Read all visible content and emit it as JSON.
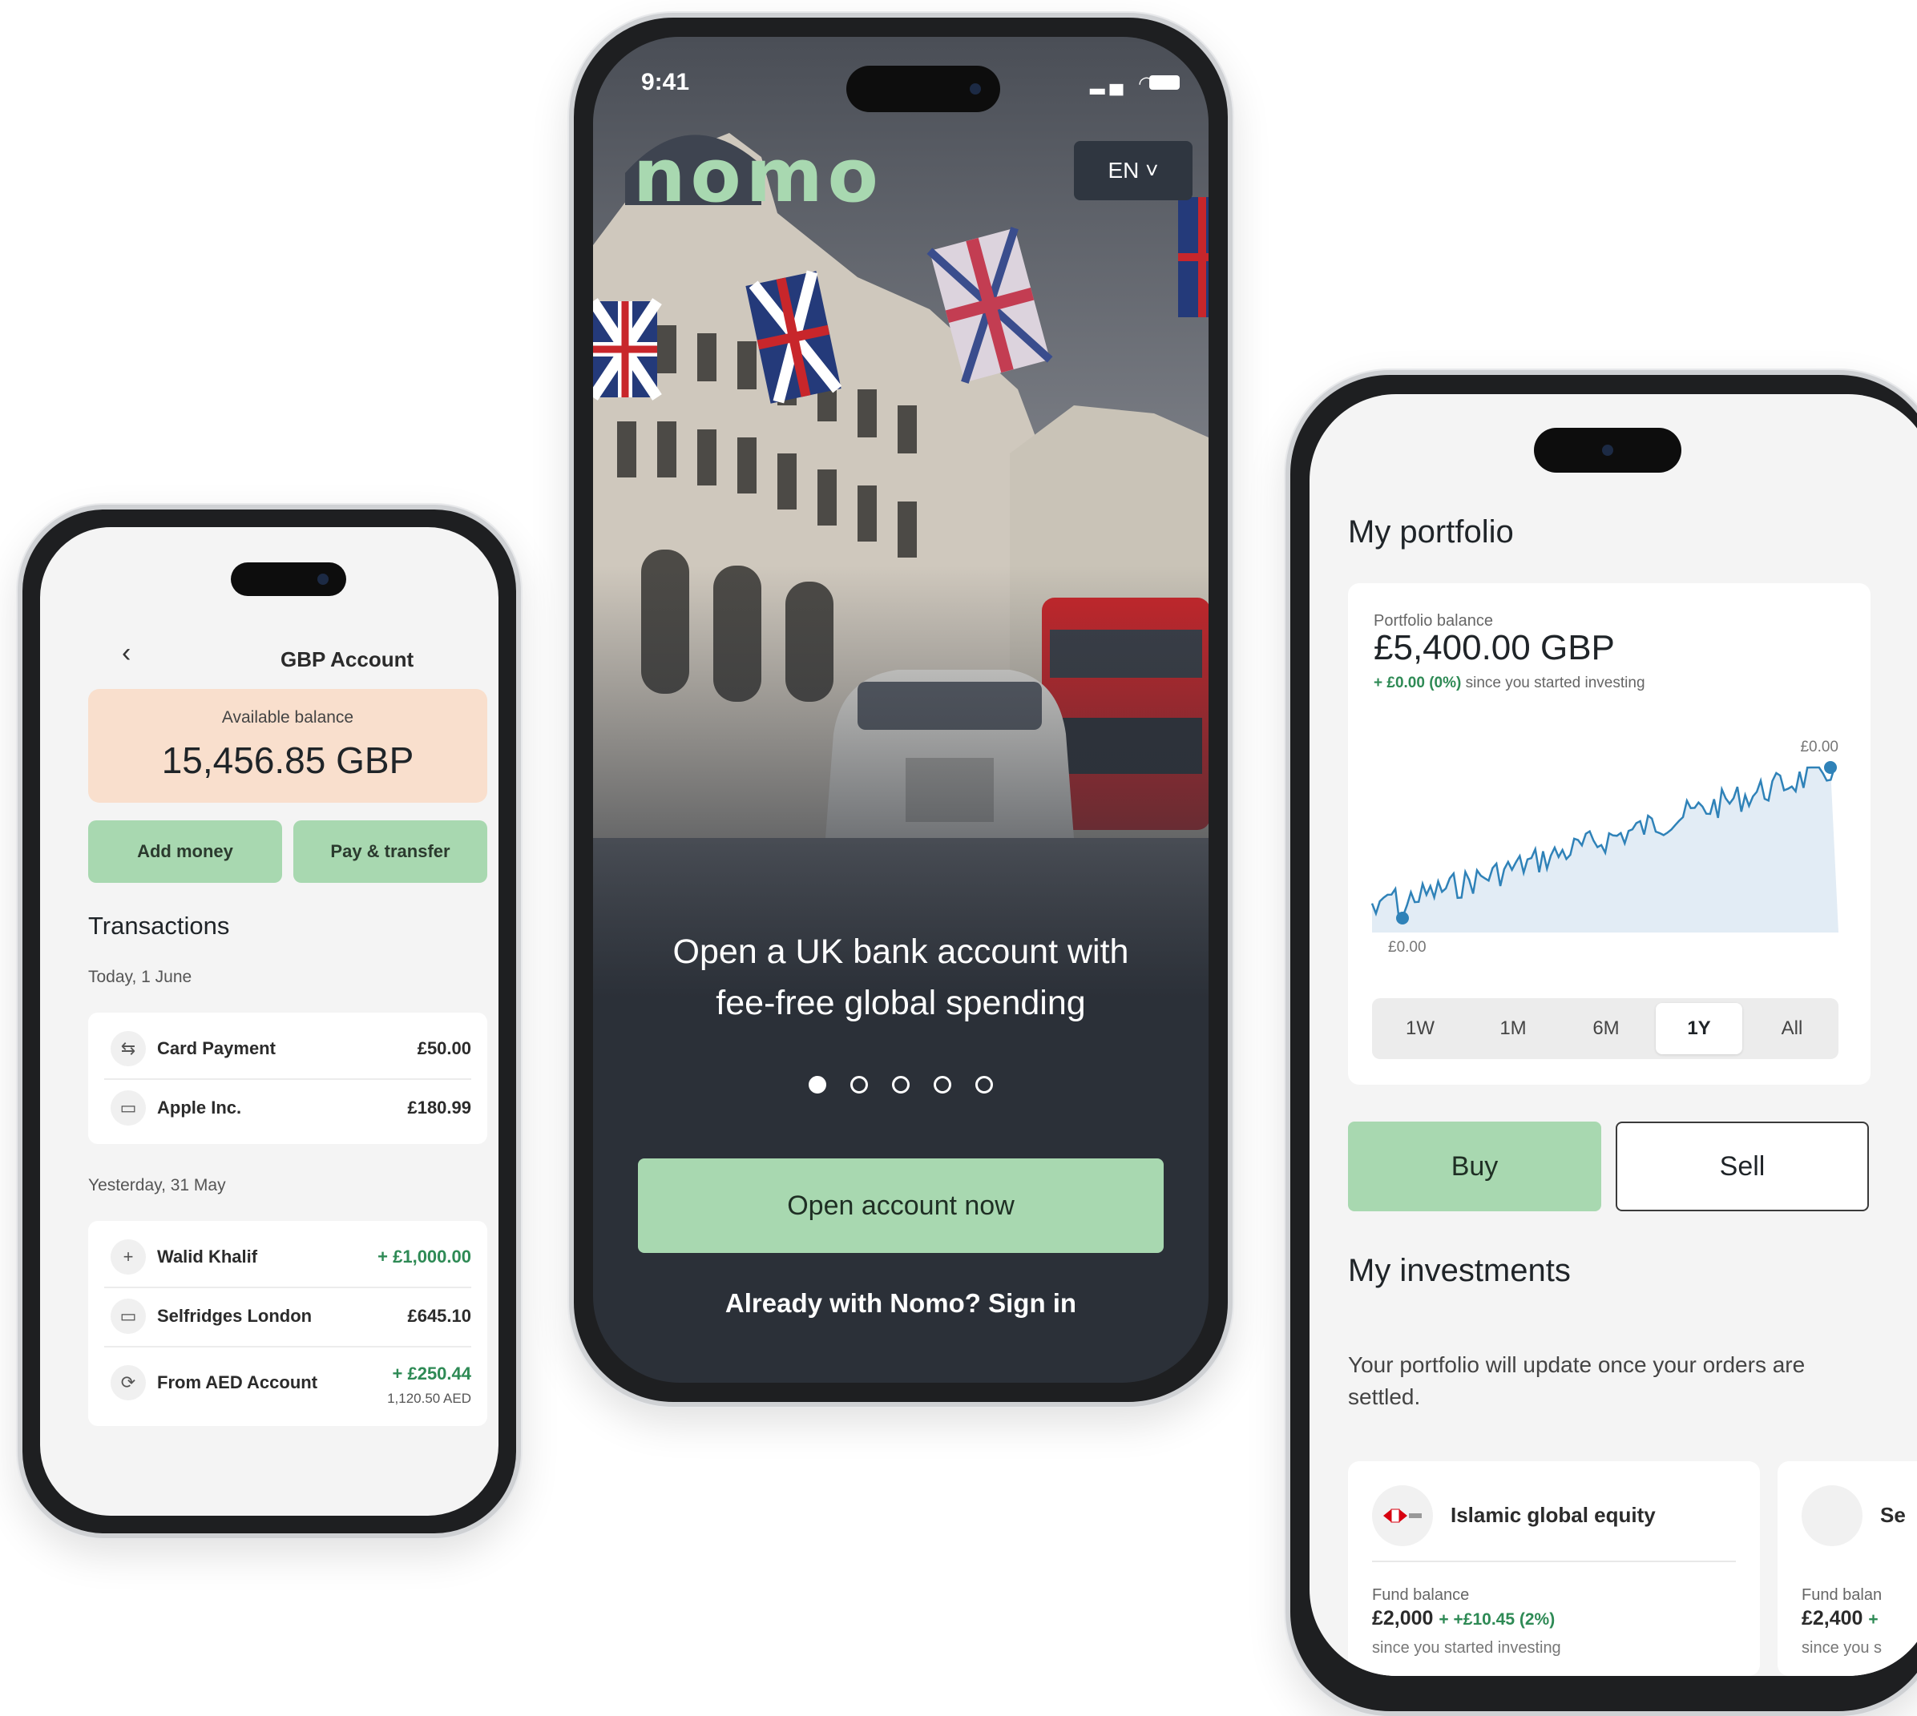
{
  "left_phone": {
    "back_icon": "chevron-left-icon",
    "title": "GBP Account",
    "balance_label": "Available balance",
    "balance_value": "15,456.85 GBP",
    "add_money": "Add money",
    "pay_transfer": "Pay & transfer",
    "section_title": "Transactions",
    "groups": [
      {
        "date": "Today, 1 June",
        "items": [
          {
            "icon": "transfer-arrows-icon",
            "name": "Card Payment",
            "amount": "£50.00"
          },
          {
            "icon": "card-icon",
            "name": "Apple Inc.",
            "amount": "£180.99"
          }
        ]
      },
      {
        "date": "Yesterday, 31 May",
        "items": [
          {
            "icon": "plus-icon",
            "name": "Walid Khalif",
            "amount": "+ £1,000.00"
          },
          {
            "icon": "card-icon",
            "name": "Selfridges London",
            "amount": "£645.10"
          },
          {
            "icon": "exchange-icon",
            "name": "From AED Account",
            "amount": "+ £250.44",
            "sub_amount": "1,120.50 AED"
          }
        ]
      }
    ]
  },
  "center_phone": {
    "status_time": "9:41",
    "logo": "nomo",
    "language": "EN ˅",
    "headline": "Open a UK bank account with fee-free global spending",
    "carousel": {
      "count": 5,
      "active": 1
    },
    "cta": "Open account now",
    "signin": "Already with Nomo? Sign in"
  },
  "right_phone": {
    "title": "My portfolio",
    "balance_label": "Portfolio balance",
    "balance_value": "£5,400.00 GBP",
    "change_value": "+ £0.00 (0%)",
    "change_text": "since you started investing",
    "chart_high_label": "£0.00",
    "chart_low_label": "£0.00",
    "ranges": [
      "1W",
      "1M",
      "6M",
      "1Y",
      "All"
    ],
    "active_range": "1Y",
    "buy": "Buy",
    "sell": "Sell",
    "investments_title": "My investments",
    "note": "Your portfolio will update once your orders are settled.",
    "investments": [
      {
        "name": "Islamic global equity",
        "fund_label": "Fund balance",
        "balance": "£2,000",
        "change": "+ +£10.45 (2%)",
        "since": "since you started investing"
      },
      {
        "name": "Se",
        "fund_label": "Fund balan",
        "balance": "£2,400",
        "change": "+",
        "since": "since you s"
      }
    ]
  },
  "colors": {
    "accent_green": "#a8d8b0",
    "balance_peach": "#f9dfcd",
    "positive_green": "#2e8a55",
    "chart_line": "#2f82b8",
    "chart_fill": "#e2ecf5"
  }
}
